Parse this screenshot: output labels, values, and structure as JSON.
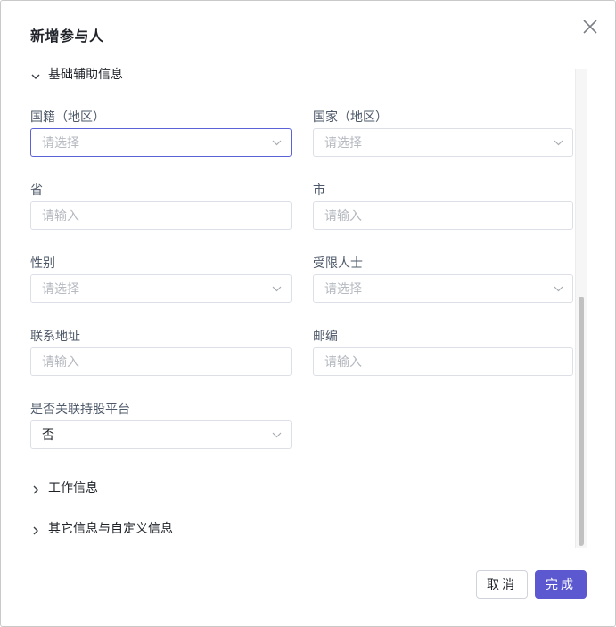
{
  "dialog": {
    "title": "新增参与人",
    "close_icon": "close-icon"
  },
  "sections": {
    "basic": {
      "label": "基础辅助信息",
      "expanded": true
    },
    "work": {
      "label": "工作信息",
      "expanded": false
    },
    "other": {
      "label": "其它信息与自定义信息",
      "expanded": false
    }
  },
  "fields": {
    "nationality": {
      "label": "国籍（地区）",
      "placeholder": "请选择",
      "value": ""
    },
    "country": {
      "label": "国家（地区）",
      "placeholder": "请选择",
      "value": ""
    },
    "province": {
      "label": "省",
      "placeholder": "请输入",
      "value": ""
    },
    "city": {
      "label": "市",
      "placeholder": "请输入",
      "value": ""
    },
    "gender": {
      "label": "性别",
      "placeholder": "请选择",
      "value": ""
    },
    "restricted": {
      "label": "受限人士",
      "placeholder": "请选择",
      "value": ""
    },
    "address": {
      "label": "联系地址",
      "placeholder": "请输入",
      "value": ""
    },
    "postcode": {
      "label": "邮编",
      "placeholder": "请输入",
      "value": ""
    },
    "platform": {
      "label": "是否关联持股平台",
      "placeholder": "",
      "value": "否"
    }
  },
  "footer": {
    "cancel_label": "取消",
    "ok_label": "完成"
  },
  "colors": {
    "accent": "#5b58d0",
    "focus_border": "#5b61d6"
  }
}
